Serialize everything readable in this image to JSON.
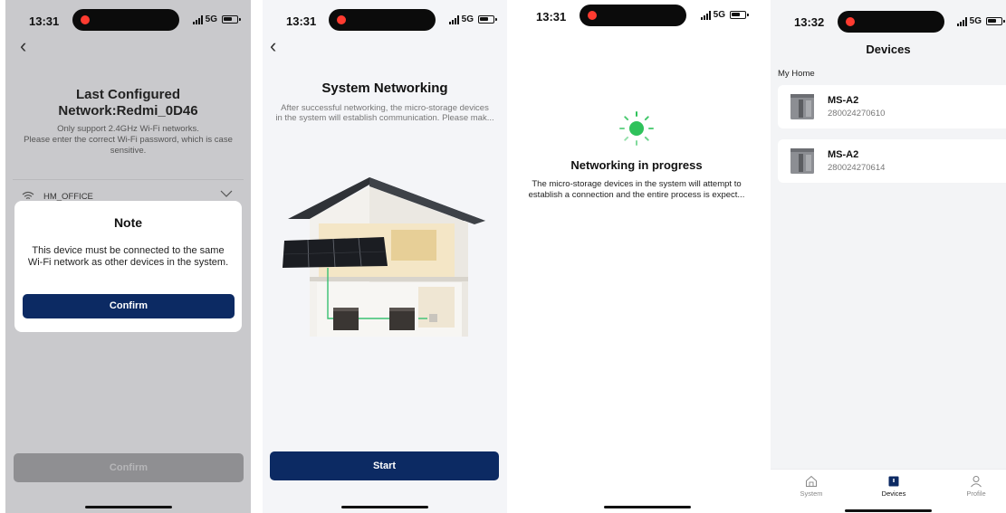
{
  "colors": {
    "primary": "#0c2a63",
    "accent_green": "#2fc25b",
    "disabled_button": "#8f8f92",
    "record_dot": "#ff3b30"
  },
  "screens": [
    {
      "status": {
        "time": "13:31",
        "network": "5G"
      },
      "title_line1": "Last Configured",
      "title_line2": "Network:Redmi_0D46",
      "hint_line1": "Only support 2.4GHz Wi-Fi networks.",
      "hint_line2": "Please enter the correct Wi-Fi password, which is case sensitive.",
      "wifi_name": "HM_OFFICE",
      "dialog": {
        "title": "Note",
        "body": "This device must be connected to the same Wi-Fi network as other devices in the system.",
        "button": "Confirm"
      },
      "bottom_button": "Confirm"
    },
    {
      "status": {
        "time": "13:31",
        "network": "5G"
      },
      "title": "System Networking",
      "description_line1": "After successful networking, the micro-storage devices",
      "description_line2": "in the system will establish communication. Please mak...",
      "button": "Start"
    },
    {
      "status": {
        "time": "13:31",
        "network": "5G"
      },
      "title": "Networking in progress",
      "description_line1": "The micro-storage devices in the system will attempt to",
      "description_line2": "establish a connection and the entire process is expect..."
    },
    {
      "status": {
        "time": "13:32",
        "network": "5G"
      },
      "title": "Devices",
      "section": "My Home",
      "devices": [
        {
          "name": "MS-A2",
          "serial": "280024270610"
        },
        {
          "name": "MS-A2",
          "serial": "280024270614"
        }
      ],
      "tabs": [
        {
          "label": "System",
          "icon": "house-icon",
          "active": false
        },
        {
          "label": "Devices",
          "icon": "device-icon",
          "active": true
        },
        {
          "label": "Profile",
          "icon": "person-icon",
          "active": false
        }
      ]
    }
  ]
}
